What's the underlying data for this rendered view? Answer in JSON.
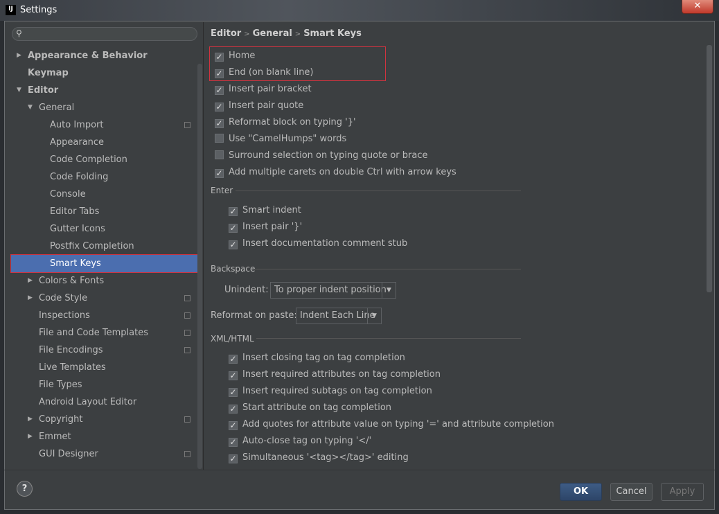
{
  "window": {
    "title": "Settings",
    "logo": "IJ",
    "close": "✕"
  },
  "search": {
    "placeholder": "",
    "icon": "search-icon"
  },
  "tree": [
    {
      "label": "Appearance & Behavior",
      "level": 0,
      "arrow": "right",
      "bold": true
    },
    {
      "label": "Keymap",
      "level": 0,
      "bold": true
    },
    {
      "label": "Editor",
      "level": 0,
      "arrow": "down",
      "bold": true
    },
    {
      "label": "General",
      "level": 1,
      "arrow": "down"
    },
    {
      "label": "Auto Import",
      "level": 2,
      "copy": true
    },
    {
      "label": "Appearance",
      "level": 2
    },
    {
      "label": "Code Completion",
      "level": 2
    },
    {
      "label": "Code Folding",
      "level": 2
    },
    {
      "label": "Console",
      "level": 2
    },
    {
      "label": "Editor Tabs",
      "level": 2
    },
    {
      "label": "Gutter Icons",
      "level": 2
    },
    {
      "label": "Postfix Completion",
      "level": 2
    },
    {
      "label": "Smart Keys",
      "level": 2,
      "selected": true
    },
    {
      "label": "Colors & Fonts",
      "level": 1,
      "arrow": "right"
    },
    {
      "label": "Code Style",
      "level": 1,
      "arrow": "right",
      "copy": true
    },
    {
      "label": "Inspections",
      "level": 1,
      "copy": true
    },
    {
      "label": "File and Code Templates",
      "level": 1,
      "copy": true
    },
    {
      "label": "File Encodings",
      "level": 1,
      "copy": true
    },
    {
      "label": "Live Templates",
      "level": 1
    },
    {
      "label": "File Types",
      "level": 1
    },
    {
      "label": "Android Layout Editor",
      "level": 1
    },
    {
      "label": "Copyright",
      "level": 1,
      "arrow": "right",
      "copy": true
    },
    {
      "label": "Emmet",
      "level": 1,
      "arrow": "right"
    },
    {
      "label": "GUI Designer",
      "level": 1,
      "copy": true
    }
  ],
  "breadcrumb": [
    "Editor",
    "General",
    "Smart Keys"
  ],
  "options": [
    {
      "label": "Home",
      "checked": true
    },
    {
      "label": "End (on blank line)",
      "checked": true
    },
    {
      "label": "Insert pair bracket",
      "checked": true
    },
    {
      "label": "Insert pair quote",
      "checked": true
    },
    {
      "label": "Reformat block on typing '}'",
      "checked": true
    },
    {
      "label": "Use \"CamelHumps\" words",
      "checked": false
    },
    {
      "label": "Surround selection on typing quote or brace",
      "checked": false
    },
    {
      "label": "Add multiple carets on double Ctrl with arrow keys",
      "checked": true
    }
  ],
  "enter": {
    "title": "Enter",
    "options": [
      {
        "label": "Smart indent",
        "checked": true
      },
      {
        "label": "Insert pair '}'",
        "checked": true
      },
      {
        "label": "Insert documentation comment stub",
        "checked": true
      }
    ]
  },
  "backspace": {
    "title": "Backspace",
    "unindent_label": "Unindent:",
    "unindent_value": "To proper indent position"
  },
  "reformat": {
    "label": "Reformat on paste:",
    "value": "Indent Each Line"
  },
  "xml": {
    "title": "XML/HTML",
    "options": [
      {
        "label": "Insert closing tag on tag completion",
        "checked": true
      },
      {
        "label": "Insert required attributes on tag completion",
        "checked": true
      },
      {
        "label": "Insert required subtags on tag completion",
        "checked": true
      },
      {
        "label": "Start attribute on tag completion",
        "checked": true
      },
      {
        "label": "Add quotes for attribute value on typing '=' and attribute completion",
        "checked": true
      },
      {
        "label": "Auto-close tag on typing '</'",
        "checked": true
      },
      {
        "label": "Simultaneous '<tag></tag>' editing",
        "checked": true
      }
    ]
  },
  "buttons": {
    "help": "?",
    "ok": "OK",
    "cancel": "Cancel",
    "apply": "Apply"
  },
  "colors": {
    "selection": "#4b6eaf",
    "highlight_box": "#d0333f",
    "background": "#3c3f41"
  }
}
